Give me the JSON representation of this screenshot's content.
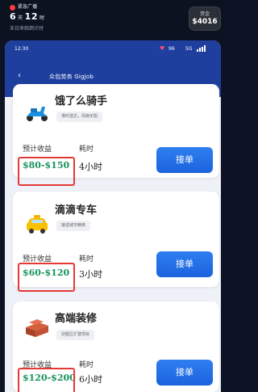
{
  "top_overlay": {
    "live_label": "紧急广播",
    "days": "6",
    "day_unit": "天",
    "hours": "12",
    "hour_unit": "时",
    "subtitle": "末日来临倒计时",
    "balance_label": "资金",
    "balance_value": "$4016"
  },
  "status_bar": {
    "time": "12:30",
    "battery": "96",
    "network": "5G"
  },
  "header": {
    "back_icon": "‹",
    "title": "众包劳务 GigJob"
  },
  "labels": {
    "income": "预计收益",
    "duration": "耗时",
    "accept": "接单"
  },
  "jobs": [
    {
      "title": "饿了么骑手",
      "tag": "准时送达，风雨无阻",
      "income": "$80-$150",
      "duration": "4小时",
      "icon": "scooter-icon"
    },
    {
      "title": "滴滴专车",
      "tag": "接送城市精英",
      "income": "$60-$120",
      "duration": "3小时",
      "icon": "taxi-icon"
    },
    {
      "title": "高端装修",
      "tag": "别墅区扩建项目",
      "income": "$120-$200",
      "duration": "6小时",
      "icon": "bricks-icon"
    }
  ],
  "colors": {
    "accent": "#1f3f9e",
    "button": "#2a72ea",
    "income": "#17935d",
    "highlight": "#e53935"
  }
}
